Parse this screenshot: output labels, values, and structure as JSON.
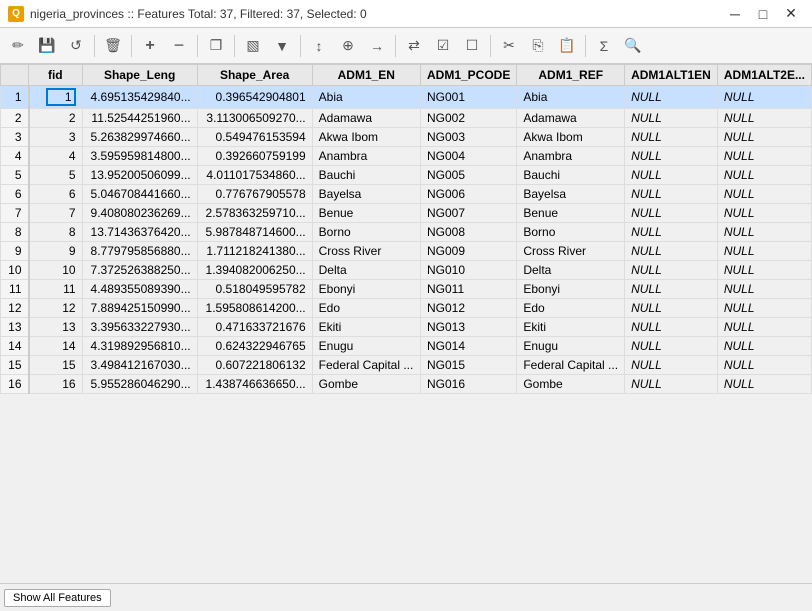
{
  "titlebar": {
    "icon": "Q",
    "title": "nigeria_provinces :: Features Total: 37, Filtered: 37, Selected: 0",
    "minimize": "─",
    "maximize": "□",
    "close": "✕"
  },
  "toolbar": {
    "buttons": [
      {
        "name": "toggle-editing",
        "icon": "✏️"
      },
      {
        "name": "save-edits",
        "icon": "💾"
      },
      {
        "name": "reload",
        "icon": "↺"
      },
      {
        "name": "separator1"
      },
      {
        "name": "delete-selected",
        "icon": "🗑"
      },
      {
        "name": "separator2"
      },
      {
        "name": "new-field",
        "icon": "➕"
      },
      {
        "name": "delete-field",
        "icon": "➖"
      },
      {
        "name": "separator3"
      },
      {
        "name": "duplicate-layer",
        "icon": "⊞"
      },
      {
        "name": "separator4"
      },
      {
        "name": "filter",
        "icon": "🔽"
      },
      {
        "name": "separator5"
      },
      {
        "name": "move-selection",
        "icon": "↕"
      },
      {
        "name": "zoom-to-selection",
        "icon": "🔍"
      },
      {
        "name": "pan-to-row",
        "icon": "↗"
      },
      {
        "name": "separator6"
      },
      {
        "name": "invert-selection",
        "icon": "⇄"
      },
      {
        "name": "select-all",
        "icon": "☑"
      },
      {
        "name": "deselect-all",
        "icon": "☐"
      },
      {
        "name": "separator7"
      },
      {
        "name": "cut",
        "icon": "✂"
      },
      {
        "name": "copy",
        "icon": "⎘"
      },
      {
        "name": "paste",
        "icon": "📋"
      },
      {
        "name": "separator8"
      },
      {
        "name": "open-calculator",
        "icon": "∑"
      },
      {
        "name": "search",
        "icon": "🔍"
      }
    ]
  },
  "columns": [
    {
      "id": "rownum",
      "label": ""
    },
    {
      "id": "fid",
      "label": "fid"
    },
    {
      "id": "shape_leng",
      "label": "Shape_Leng"
    },
    {
      "id": "shape_area",
      "label": "Shape_Area"
    },
    {
      "id": "adm1_en",
      "label": "ADM1_EN"
    },
    {
      "id": "adm1_pcode",
      "label": "ADM1_PCODE"
    },
    {
      "id": "adm1_ref",
      "label": "ADM1_REF"
    },
    {
      "id": "adm1alt1en",
      "label": "ADM1ALT1EN"
    },
    {
      "id": "adm1alt2en",
      "label": "ADM1ALT2E..."
    }
  ],
  "rows": [
    {
      "rownum": 1,
      "fid": 1,
      "shape_leng": "4.695135429840...",
      "shape_area": "0.396542904801",
      "adm1_en": "Abia",
      "adm1_pcode": "NG001",
      "adm1_ref": "Abia",
      "adm1alt1en": "NULL",
      "adm1alt2en": "NULL"
    },
    {
      "rownum": 2,
      "fid": 2,
      "shape_leng": "11.52544251960...",
      "shape_area": "3.113006509270...",
      "adm1_en": "Adamawa",
      "adm1_pcode": "NG002",
      "adm1_ref": "Adamawa",
      "adm1alt1en": "NULL",
      "adm1alt2en": "NULL"
    },
    {
      "rownum": 3,
      "fid": 3,
      "shape_leng": "5.263829974660...",
      "shape_area": "0.549476153594",
      "adm1_en": "Akwa Ibom",
      "adm1_pcode": "NG003",
      "adm1_ref": "Akwa Ibom",
      "adm1alt1en": "NULL",
      "adm1alt2en": "NULL"
    },
    {
      "rownum": 4,
      "fid": 4,
      "shape_leng": "3.595959814800...",
      "shape_area": "0.392660759199",
      "adm1_en": "Anambra",
      "adm1_pcode": "NG004",
      "adm1_ref": "Anambra",
      "adm1alt1en": "NULL",
      "adm1alt2en": "NULL"
    },
    {
      "rownum": 5,
      "fid": 5,
      "shape_leng": "13.95200506099...",
      "shape_area": "4.011017534860...",
      "adm1_en": "Bauchi",
      "adm1_pcode": "NG005",
      "adm1_ref": "Bauchi",
      "adm1alt1en": "NULL",
      "adm1alt2en": "NULL"
    },
    {
      "rownum": 6,
      "fid": 6,
      "shape_leng": "5.046708441660...",
      "shape_area": "0.776767905578",
      "adm1_en": "Bayelsa",
      "adm1_pcode": "NG006",
      "adm1_ref": "Bayelsa",
      "adm1alt1en": "NULL",
      "adm1alt2en": "NULL"
    },
    {
      "rownum": 7,
      "fid": 7,
      "shape_leng": "9.408080236269...",
      "shape_area": "2.578363259710...",
      "adm1_en": "Benue",
      "adm1_pcode": "NG007",
      "adm1_ref": "Benue",
      "adm1alt1en": "NULL",
      "adm1alt2en": "NULL"
    },
    {
      "rownum": 8,
      "fid": 8,
      "shape_leng": "13.71436376420...",
      "shape_area": "5.987848714600...",
      "adm1_en": "Borno",
      "adm1_pcode": "NG008",
      "adm1_ref": "Borno",
      "adm1alt1en": "NULL",
      "adm1alt2en": "NULL"
    },
    {
      "rownum": 9,
      "fid": 9,
      "shape_leng": "8.779795856880...",
      "shape_area": "1.711218241380...",
      "adm1_en": "Cross River",
      "adm1_pcode": "NG009",
      "adm1_ref": "Cross River",
      "adm1alt1en": "NULL",
      "adm1alt2en": "NULL"
    },
    {
      "rownum": 10,
      "fid": 10,
      "shape_leng": "7.372526388250...",
      "shape_area": "1.394082006250...",
      "adm1_en": "Delta",
      "adm1_pcode": "NG010",
      "adm1_ref": "Delta",
      "adm1alt1en": "NULL",
      "adm1alt2en": "NULL"
    },
    {
      "rownum": 11,
      "fid": 11,
      "shape_leng": "4.489355089390...",
      "shape_area": "0.518049595782",
      "adm1_en": "Ebonyi",
      "adm1_pcode": "NG011",
      "adm1_ref": "Ebonyi",
      "adm1alt1en": "NULL",
      "adm1alt2en": "NULL"
    },
    {
      "rownum": 12,
      "fid": 12,
      "shape_leng": "7.889425150990...",
      "shape_area": "1.595808614200...",
      "adm1_en": "Edo",
      "adm1_pcode": "NG012",
      "adm1_ref": "Edo",
      "adm1alt1en": "NULL",
      "adm1alt2en": "NULL"
    },
    {
      "rownum": 13,
      "fid": 13,
      "shape_leng": "3.395633227930...",
      "shape_area": "0.471633721676",
      "adm1_en": "Ekiti",
      "adm1_pcode": "NG013",
      "adm1_ref": "Ekiti",
      "adm1alt1en": "NULL",
      "adm1alt2en": "NULL"
    },
    {
      "rownum": 14,
      "fid": 14,
      "shape_leng": "4.319892956810...",
      "shape_area": "0.624322946765",
      "adm1_en": "Enugu",
      "adm1_pcode": "NG014",
      "adm1_ref": "Enugu",
      "adm1alt1en": "NULL",
      "adm1alt2en": "NULL"
    },
    {
      "rownum": 15,
      "fid": 15,
      "shape_leng": "3.498412167030...",
      "shape_area": "0.607221806132",
      "adm1_en": "Federal Capital ...",
      "adm1_pcode": "NG015",
      "adm1_ref": "Federal Capital ...",
      "adm1alt1en": "NULL",
      "adm1alt2en": "NULL"
    },
    {
      "rownum": 16,
      "fid": 16,
      "shape_leng": "5.955286046290...",
      "shape_area": "1.438746636650...",
      "adm1_en": "Gombe",
      "adm1_pcode": "NG016",
      "adm1_ref": "Gombe",
      "adm1alt1en": "NULL",
      "adm1alt2en": "NULL"
    }
  ],
  "bottom": {
    "show_all_label": "Show All Features"
  },
  "icons": {
    "pencil": "✏",
    "save": "💾",
    "reload": "↺",
    "trash": "🗑",
    "add_col": "+",
    "del_col": "−",
    "copy_layer": "❐",
    "filter": "▼",
    "move_sel": "↕",
    "zoom": "⊕",
    "pan": "→",
    "invert": "⇄",
    "sel_all": "☑",
    "desel": "☐",
    "cut": "✂",
    "copy": "⎘",
    "paste": "📋",
    "calc": "Σ",
    "search": "🔍"
  }
}
